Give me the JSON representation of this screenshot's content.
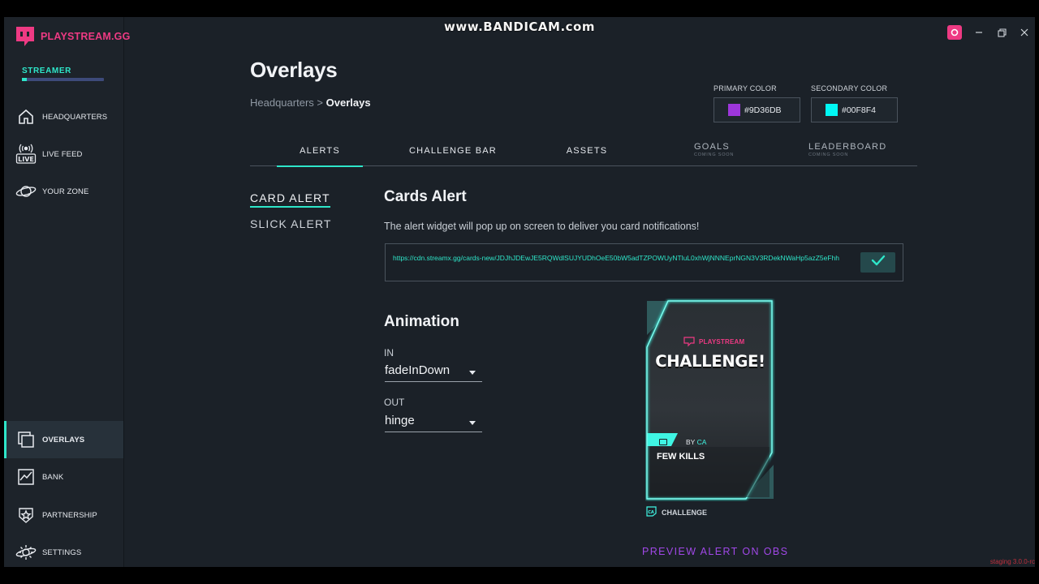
{
  "watermark": "www.BANDICAM.com",
  "brand": {
    "name": "PLAYSTREAM.GG",
    "accent": "#ee3a83",
    "teal": "#2ee6c9"
  },
  "user": {
    "role": "STREAMER",
    "progress": 0.06
  },
  "sidebar": {
    "items": [
      {
        "label": "HEADQUARTERS",
        "icon": "home-icon"
      },
      {
        "label": "LIVE FEED",
        "icon": "live-icon"
      },
      {
        "label": "YOUR ZONE",
        "icon": "planet-icon"
      },
      {
        "label": "OVERLAYS",
        "icon": "overlays-icon",
        "active": true
      },
      {
        "label": "BANK",
        "icon": "chart-icon"
      },
      {
        "label": "PARTNERSHIP",
        "icon": "star-icon"
      },
      {
        "label": "SETTINGS",
        "icon": "gear-icon"
      }
    ]
  },
  "window": {
    "controls": [
      "profile-icon",
      "minimize-icon",
      "restore-icon",
      "close-icon"
    ]
  },
  "page": {
    "title": "Overlays",
    "breadcrumb": {
      "parent": "Headquarters",
      "separator": ">",
      "current": "Overlays"
    }
  },
  "colors": {
    "primary": {
      "label": "PRIMARY COLOR",
      "value": "#9D36DB"
    },
    "secondary": {
      "label": "SECONDARY COLOR",
      "value": "#00F8F4"
    }
  },
  "tabs": [
    {
      "label": "ALERTS",
      "active": true
    },
    {
      "label": "CHALLENGE BAR"
    },
    {
      "label": "ASSETS"
    },
    {
      "label": "GOALS",
      "sub": "COMING SOON"
    },
    {
      "label": "LEADERBOARD",
      "sub": "COMING SOON"
    }
  ],
  "subnav": [
    {
      "label": "CARD ALERT",
      "active": true
    },
    {
      "label": "SLICK ALERT"
    }
  ],
  "cards_alert": {
    "title": "Cards Alert",
    "description": "The alert widget will pop up on screen to deliver you card notifications!",
    "url": "https://cdn.streamx.gg/cards-new/JDJhJDEwJE5RQWdlSUJYUDhOeE50bW5adTZPOWUyNTluL0xhWjNNNEprNGN3V3RDekNWaHp5azZ5eFhh",
    "copy_icon": "check-icon"
  },
  "animation": {
    "title": "Animation",
    "in": {
      "label": "IN",
      "value": "fadeInDown"
    },
    "out": {
      "label": "OUT",
      "value": "hinge"
    }
  },
  "card_preview": {
    "brand": "PLAYSTREAM",
    "headline": "CHALLENGE!",
    "by_prefix": "BY",
    "by_name": "CA",
    "task": "FEW KILLS",
    "footer": "CHALLENGE"
  },
  "preview_link": "PREVIEW ALERT ON OBS",
  "version": "staging 3.0.0-rc"
}
